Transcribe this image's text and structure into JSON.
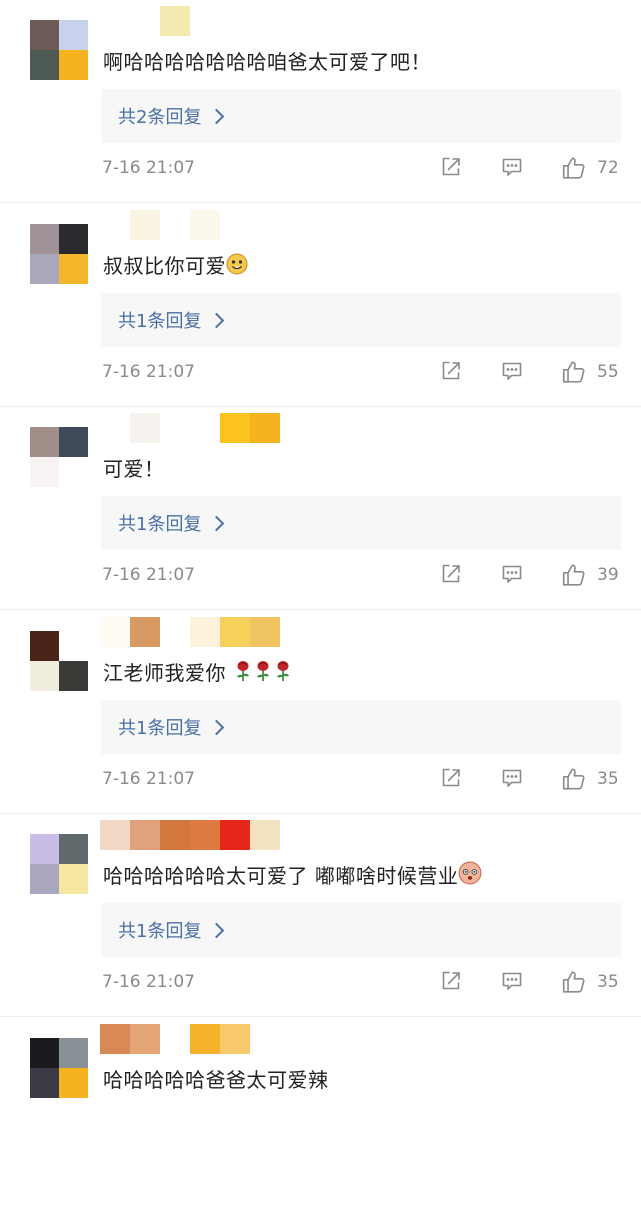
{
  "comments": [
    {
      "text": "啊哈哈哈哈哈哈哈咱爸太可爱了吧！",
      "replies_label": "共2条回复",
      "time": "7-16 21:07",
      "likes": "72",
      "avatar_colors": [
        "#6e5b58",
        "#c9d2ec",
        "#4e5a56",
        "#f6b21f"
      ],
      "name_colors": [
        "#ffffff",
        "#ffffff",
        "#f2eab0"
      ]
    },
    {
      "text": "叔叔比你可爱",
      "emoji": "grin-emoji",
      "replies_label": "共1条回复",
      "time": "7-16 21:07",
      "likes": "55",
      "avatar_colors": [
        "#a19299",
        "#2a2a2e",
        "#a8a7bb",
        "#f4b62a"
      ],
      "name_colors": [
        "#ffffff",
        "#f9f3e1",
        "#ffffff",
        "#fbf8ec"
      ]
    },
    {
      "text": "可爱！",
      "replies_label": "共1条回复",
      "time": "7-16 21:07",
      "likes": "39",
      "avatar_colors": [
        "#a28f8a",
        "#3f4a5a",
        "#f8f4f4",
        "#ffffff"
      ],
      "name_colors": [
        "#ffffff",
        "#f6f2ee",
        "#ffffff",
        "#ffffff",
        "#fbc31b",
        "#f6b31d"
      ]
    },
    {
      "text": "江老师我爱你",
      "emoji": "rose-emoji",
      "replies_label": "共1条回复",
      "time": "7-16 21:07",
      "likes": "35",
      "avatar_colors": [
        "#4a2418",
        "#ffffff",
        "#f1eddf",
        "#3a3a36"
      ],
      "name_colors": [
        "#fffaf2",
        "#d89a62",
        "#ffffff",
        "#fdf3dc",
        "#f7d05a",
        "#f0c460"
      ]
    },
    {
      "text": "哈哈哈哈哈哈太可爱了 嘟嘟啥时候营业",
      "emoji": "face-emoji",
      "replies_label": "共1条回复",
      "time": "7-16 21:07",
      "likes": "35",
      "avatar_colors": [
        "#c8bde6",
        "#606a6c",
        "#a9a7bd",
        "#f6e7a0"
      ],
      "name_colors": [
        "#f2d9c6",
        "#e0a27a",
        "#d2783e",
        "#df7a40",
        "#e5281a",
        "#f3e3c0"
      ]
    },
    {
      "text": "哈哈哈哈哈爸爸太可爱辣",
      "avatar_colors": [
        "#1a1a1f",
        "#8a9196",
        "#3a3a44",
        "#f6b21f"
      ],
      "name_colors": [
        "#d98a54",
        "#e5a476",
        "#ffffff",
        "#f5b22a",
        "#f7c96a"
      ]
    }
  ]
}
